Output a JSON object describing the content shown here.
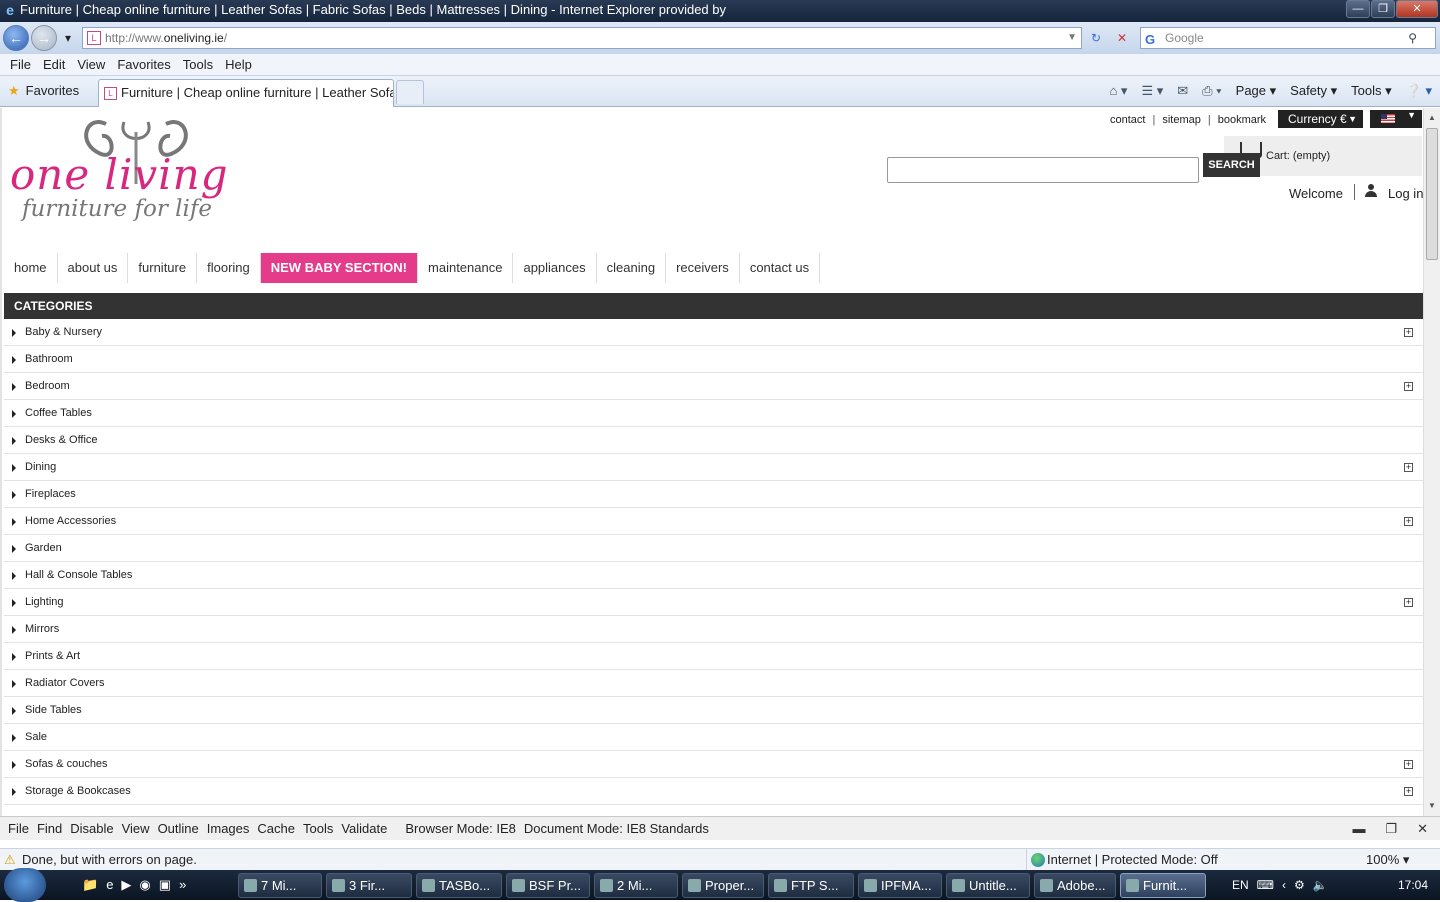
{
  "browser": {
    "window_title": "Furniture | Cheap online furniture | Leather Sofas | Fabric Sofas | Beds | Mattresses | Dining  - Internet Explorer provided by",
    "url_prefix": "http://www.",
    "url_domain": "oneliving.ie",
    "url_suffix": "/",
    "search_placeholder": "Google",
    "menu": [
      "File",
      "Edit",
      "View",
      "Favorites",
      "Tools",
      "Help"
    ],
    "favorites_label": "Favorites",
    "tab_title": "Furniture | Cheap online furniture | Leather Sofas ...",
    "commands": [
      "Page",
      "Safety",
      "Tools"
    ]
  },
  "site": {
    "logo_text": "one living",
    "logo_tagline": "furniture for life",
    "top_links": [
      "contact",
      "sitemap",
      "bookmark"
    ],
    "currency_label": "Currency €",
    "search_button": "SEARCH",
    "cart_label": "Cart: (empty)",
    "welcome": "Welcome",
    "login": "Log in",
    "nav": [
      "home",
      "about us",
      "furniture",
      "flooring",
      "NEW BABY SECTION!",
      "maintenance",
      "appliances",
      "cleaning",
      "receivers",
      "contact us"
    ],
    "nav_active_index": 4,
    "categories_title": "CATEGORIES",
    "categories": [
      {
        "label": "Baby & Nursery",
        "expandable": true
      },
      {
        "label": "Bathroom",
        "expandable": false
      },
      {
        "label": "Bedroom",
        "expandable": true
      },
      {
        "label": "Coffee Tables",
        "expandable": false
      },
      {
        "label": "Desks & Office",
        "expandable": false
      },
      {
        "label": "Dining",
        "expandable": true
      },
      {
        "label": "Fireplaces",
        "expandable": false
      },
      {
        "label": "Home Accessories",
        "expandable": true
      },
      {
        "label": "Garden",
        "expandable": false
      },
      {
        "label": "Hall & Console Tables",
        "expandable": false
      },
      {
        "label": "Lighting",
        "expandable": true
      },
      {
        "label": "Mirrors",
        "expandable": false
      },
      {
        "label": "Prints & Art",
        "expandable": false
      },
      {
        "label": "Radiator Covers",
        "expandable": false
      },
      {
        "label": "Side Tables",
        "expandable": false
      },
      {
        "label": "Sale",
        "expandable": false
      },
      {
        "label": "Sofas & couches",
        "expandable": true
      },
      {
        "label": "Storage & Bookcases",
        "expandable": true
      }
    ],
    "accent_color": "#e43b8b",
    "dark_color": "#333333"
  },
  "devtools": {
    "items": [
      "File",
      "Find",
      "Disable",
      "View",
      "Outline",
      "Images",
      "Cache",
      "Tools",
      "Validate"
    ],
    "browser_mode": "Browser Mode:  IE8",
    "document_mode": "Document Mode:  IE8 Standards"
  },
  "status": {
    "text": "Done, but with errors on page.",
    "zone": "Internet | Protected Mode: Off",
    "zoom": "100%"
  },
  "taskbar": {
    "tasks": [
      "7 Mi...",
      "3 Fir...",
      "TASBo...",
      "BSF Pr...",
      "2 Mi...",
      "Proper...",
      "FTP S...",
      "IPFMA...",
      "Untitle...",
      "Adobe...",
      "Furnit..."
    ],
    "active_task_index": 10,
    "lang": "EN",
    "clock": "17:04"
  }
}
